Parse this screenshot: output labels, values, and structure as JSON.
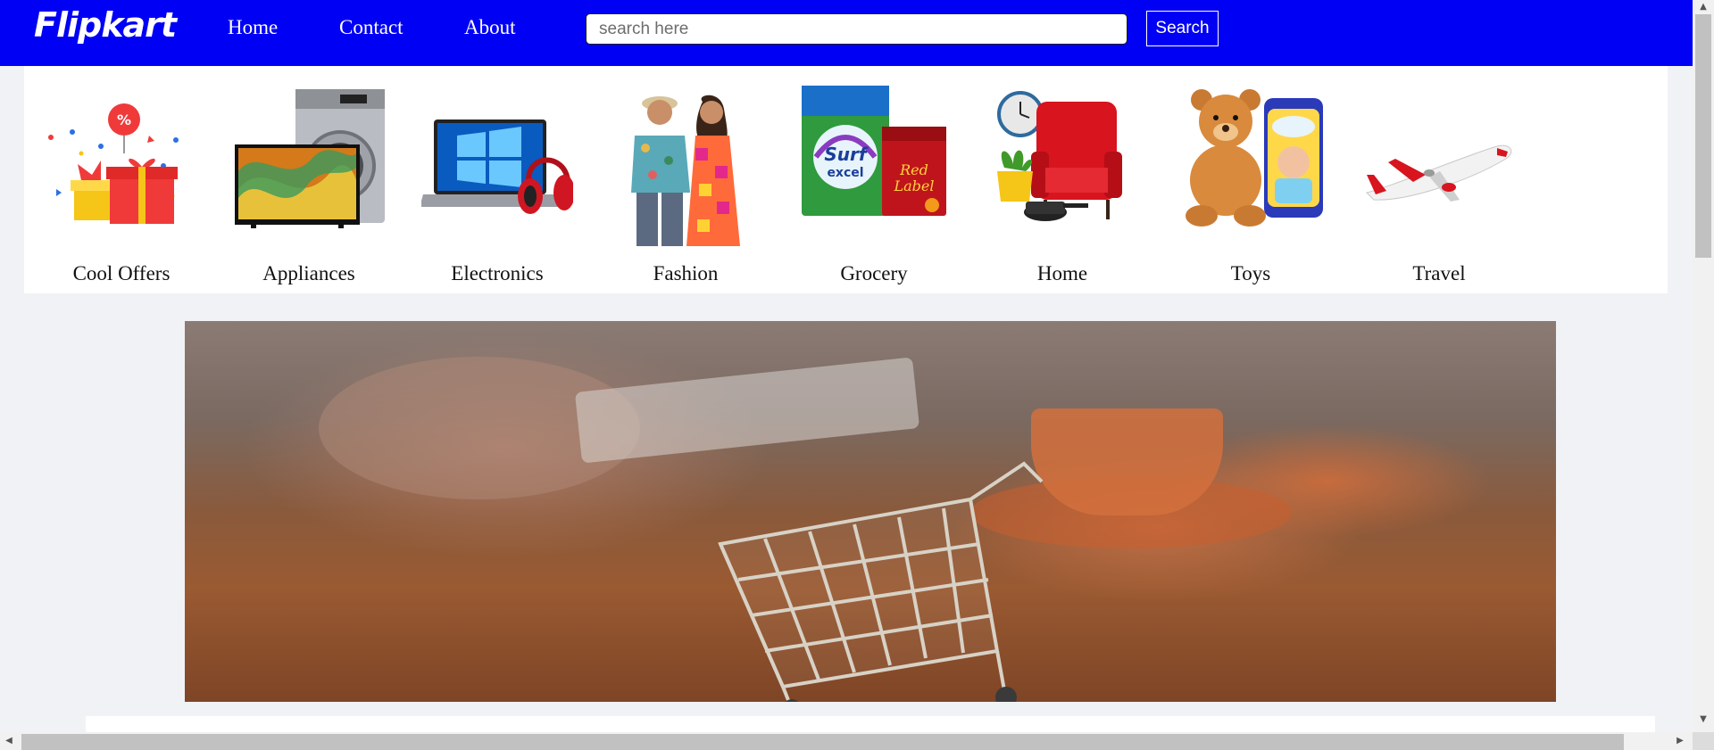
{
  "navbar": {
    "logo": "Flipkart",
    "links": [
      {
        "label": "Home"
      },
      {
        "label": "Contact"
      },
      {
        "label": "About"
      }
    ],
    "search_placeholder": "search here",
    "search_value": "",
    "search_button": "Search",
    "bg_color": "#0000f5"
  },
  "categories": [
    {
      "label": "Cool Offers",
      "icon": "gift-offers-icon"
    },
    {
      "label": "Appliances",
      "icon": "tv-washing-machine-icon"
    },
    {
      "label": "Electronics",
      "icon": "laptop-headphones-icon"
    },
    {
      "label": "Fashion",
      "icon": "fashion-models-icon"
    },
    {
      "label": "Grocery",
      "icon": "detergent-tea-icon"
    },
    {
      "label": "Home",
      "icon": "armchair-plant-icon"
    },
    {
      "label": "Toys",
      "icon": "teddy-bear-diapers-icon"
    },
    {
      "label": "Travel",
      "icon": "airplane-icon"
    }
  ],
  "banner": {
    "image": "shopping-cart-on-wooden-desk"
  },
  "scrollbars": {
    "vertical_up": "▲",
    "vertical_down": "▼",
    "horizontal_left": "◀",
    "horizontal_right": "▶"
  }
}
